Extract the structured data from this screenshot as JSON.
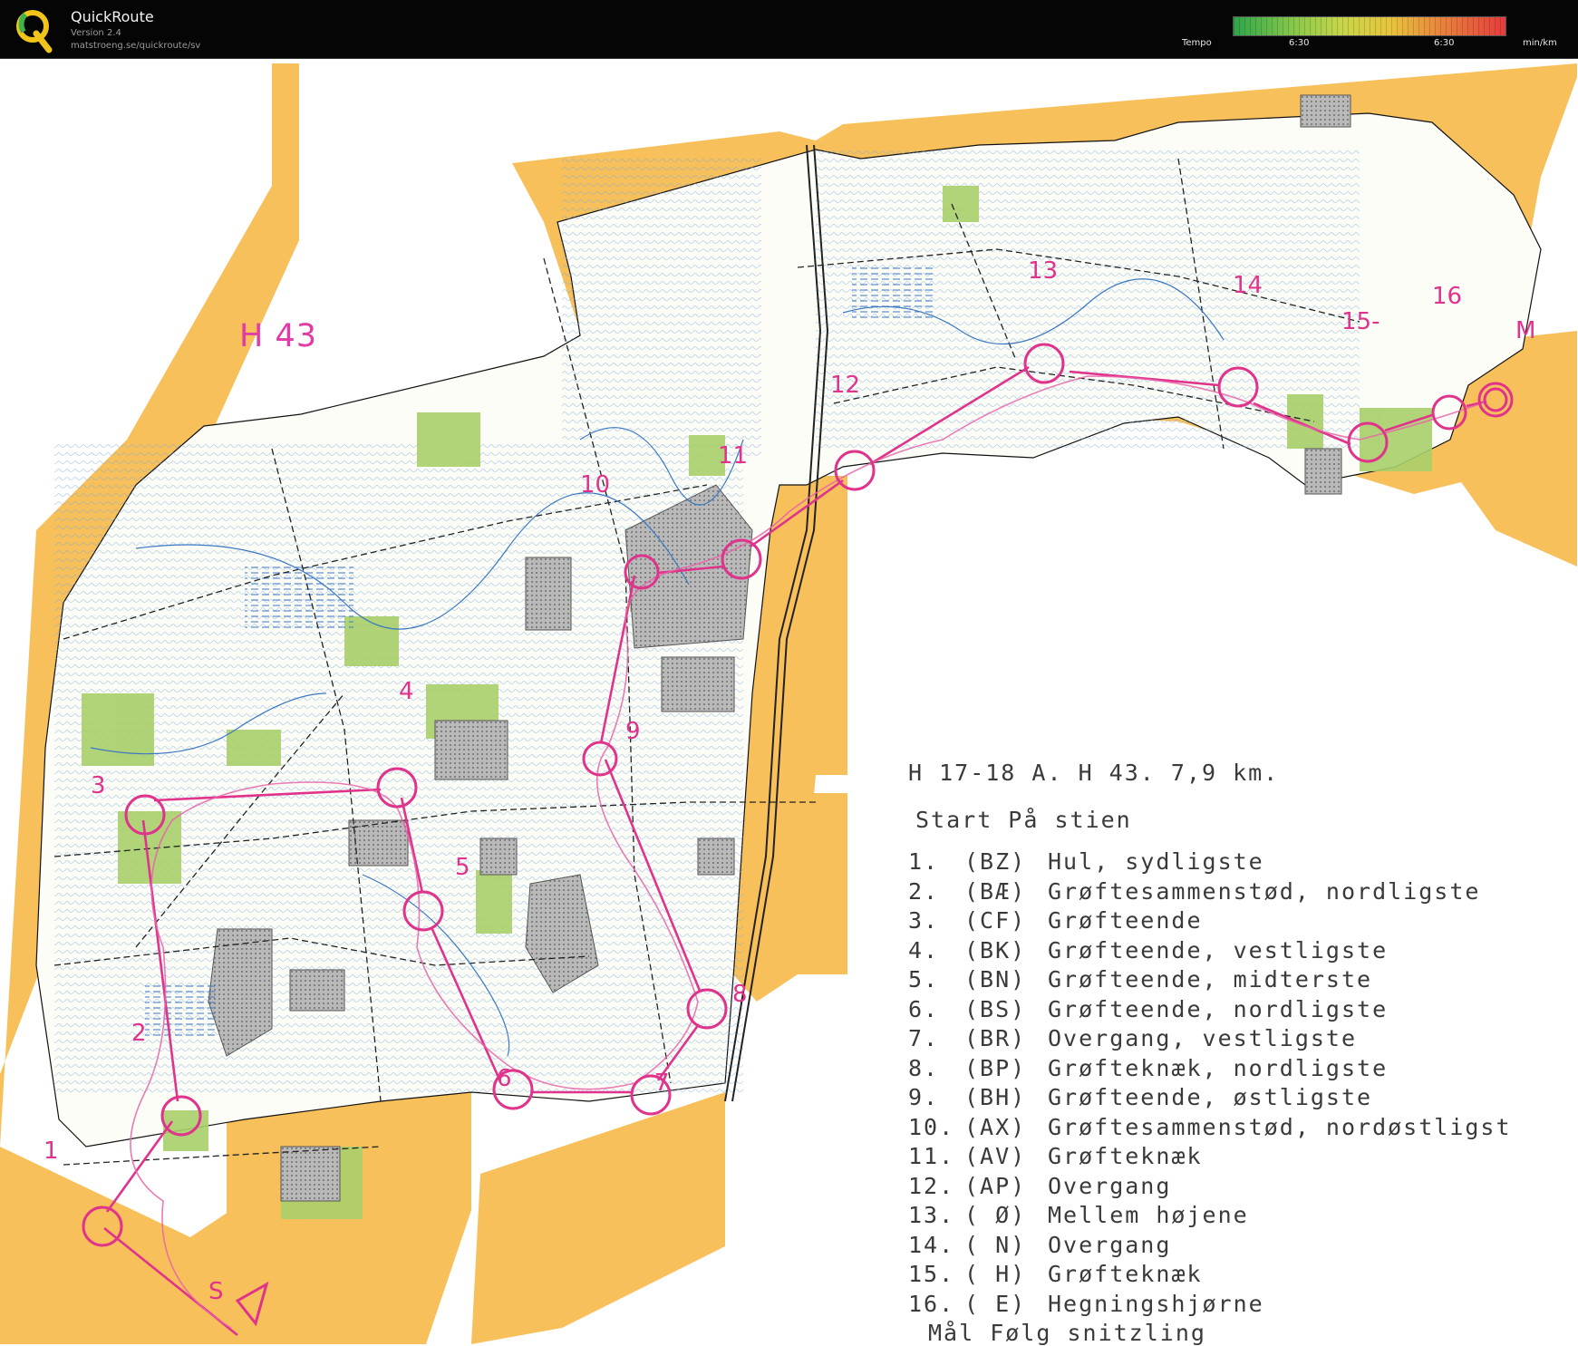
{
  "app": {
    "name": "QuickRoute",
    "version": "Version 2.4",
    "url": "matstroeng.se/quickroute/sv"
  },
  "legend": {
    "label": "Tempo",
    "min": "6:30",
    "max": "6:30",
    "unit": "min/km"
  },
  "map": {
    "course_label": "H 43",
    "route_color": "#e0338c",
    "controls": [
      {
        "label": "1"
      },
      {
        "label": "2"
      },
      {
        "label": "3"
      },
      {
        "label": "4"
      },
      {
        "label": "5"
      },
      {
        "label": "6"
      },
      {
        "label": "7"
      },
      {
        "label": "8"
      },
      {
        "label": "9"
      },
      {
        "label": "10"
      },
      {
        "label": "11"
      },
      {
        "label": "12"
      },
      {
        "label": "13"
      },
      {
        "label": "14"
      },
      {
        "label": "15-"
      },
      {
        "label": "16"
      }
    ],
    "start_label": "S",
    "finish_label": "M"
  },
  "description": {
    "header": "H 17-18 A.  H 43. 7,9 km.",
    "start": "Start På stien",
    "items": [
      {
        "num": "1.",
        "code": "(BZ)",
        "text": "Hul, sydligste"
      },
      {
        "num": "2.",
        "code": "(BÆ)",
        "text": "Grøftesammenstød, nordligste"
      },
      {
        "num": "3.",
        "code": "(CF)",
        "text": "Grøfteende"
      },
      {
        "num": "4.",
        "code": "(BK)",
        "text": "Grøfteende, vestligste"
      },
      {
        "num": "5.",
        "code": "(BN)",
        "text": "Grøfteende, midterste"
      },
      {
        "num": "6.",
        "code": "(BS)",
        "text": "Grøfteende, nordligste"
      },
      {
        "num": "7.",
        "code": "(BR)",
        "text": "Overgang, vestligste"
      },
      {
        "num": "8.",
        "code": "(BP)",
        "text": "Grøfteknæk, nordligste"
      },
      {
        "num": "9.",
        "code": "(BH)",
        "text": "Grøfteende, østligste"
      },
      {
        "num": "10.",
        "code": "(AX)",
        "text": "Grøftesammenstød, nordøstligst"
      },
      {
        "num": "11.",
        "code": "(AV)",
        "text": "Grøfteknæk"
      },
      {
        "num": "12.",
        "code": "(AP)",
        "text": "Overgang"
      },
      {
        "num": "13.",
        "code": "( Ø)",
        "text": "Mellem højene"
      },
      {
        "num": "14.",
        "code": "( N)",
        "text": "Overgang"
      },
      {
        "num": "15.",
        "code": "( H)",
        "text": "Grøfteknæk"
      },
      {
        "num": "16.",
        "code": "( E)",
        "text": "Hegningshjørne"
      }
    ],
    "finish": "Mål Følg snitzling"
  }
}
